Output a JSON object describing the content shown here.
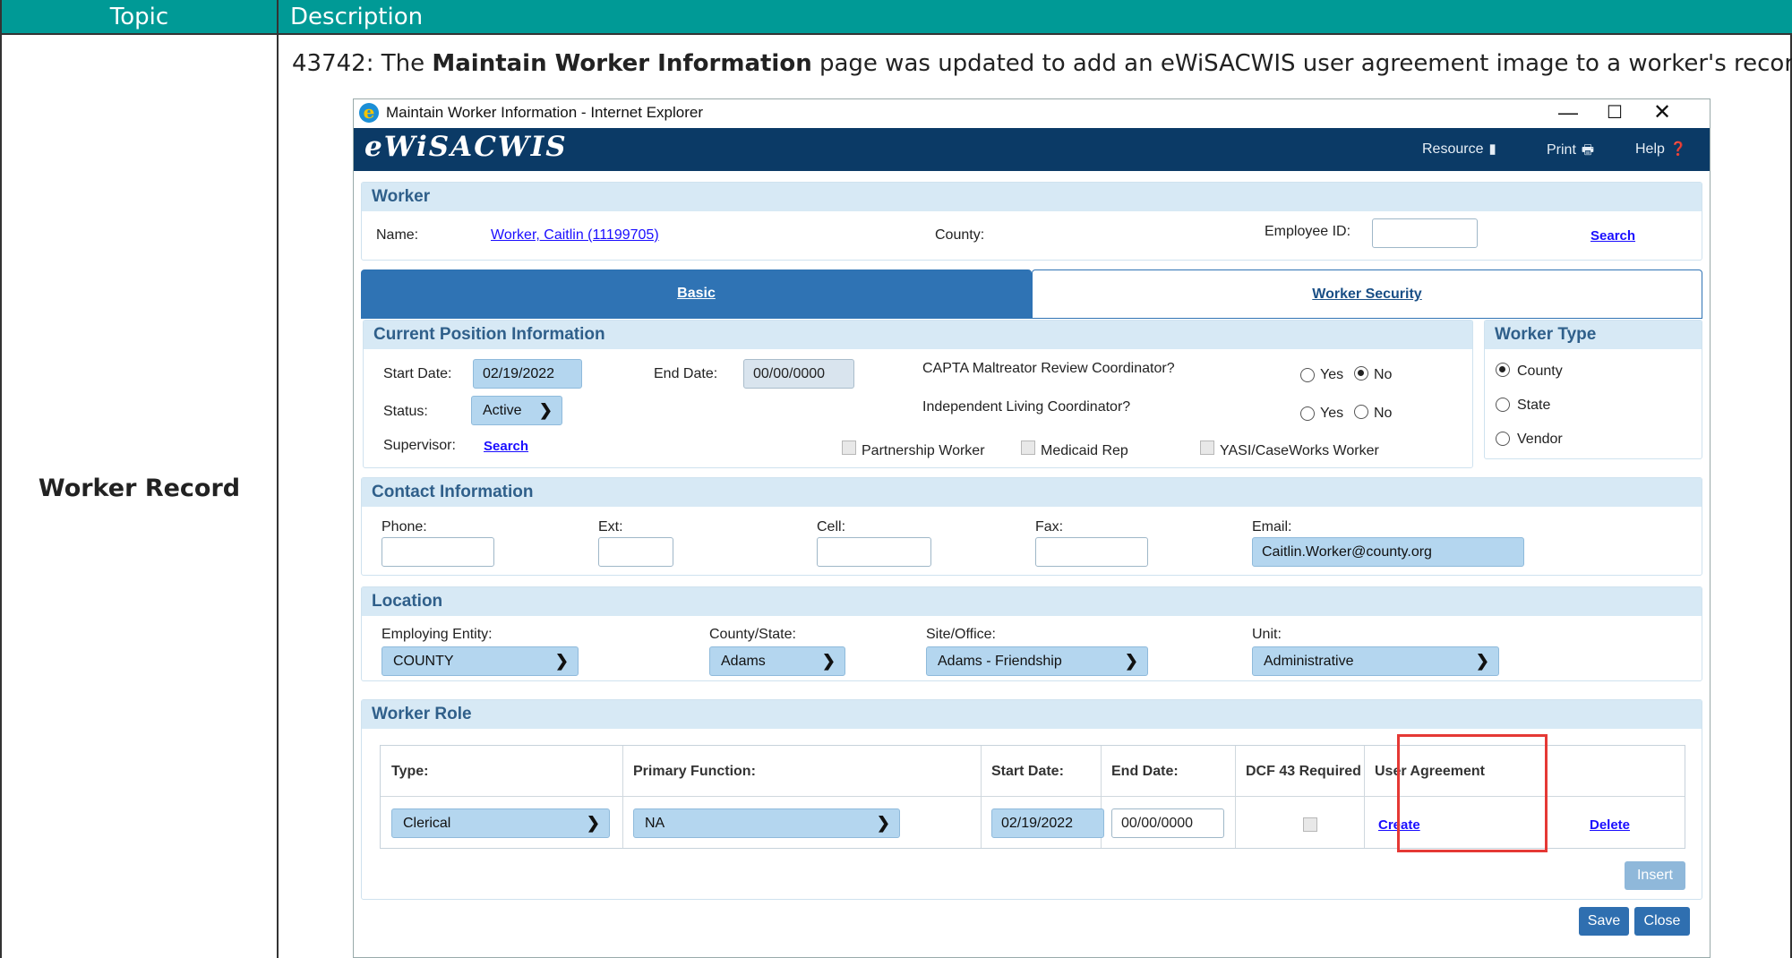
{
  "doc": {
    "header_topic": "Topic",
    "header_description": "Description",
    "topic": "Worker Record",
    "desc_prefix": "43742: The ",
    "desc_bold": "Maintain Worker Information",
    "desc_suffix": " page was updated to add an eWiSACWIS user agreement image to a worker's record."
  },
  "window": {
    "title": "Maintain Worker Information - Internet Explorer",
    "minimize": "—",
    "maximize": "☐",
    "close": "✕"
  },
  "banner": {
    "logo": "eWiSACWIS",
    "resource": "Resource",
    "print": "Print",
    "help": "Help"
  },
  "worker": {
    "heading": "Worker",
    "name_label": "Name:",
    "name_value": "Worker, Caitlin  (11199705)",
    "county_label": "County:",
    "employee_id_label": "Employee ID:",
    "employee_id_value": "",
    "search": "Search"
  },
  "tabs": {
    "basic": "Basic",
    "security": "Worker Security"
  },
  "position": {
    "heading": "Current Position Information",
    "start_label": "Start Date:",
    "start_value": "02/19/2022",
    "end_label": "End Date:",
    "end_value": "00/00/0000",
    "captа_question": "CAPTA Maltreator Review Coordinator?",
    "ilc_question": "Independent Living Coordinator?",
    "yes": "Yes",
    "no": "No",
    "status_label": "Status:",
    "status_value": "Active",
    "supervisor_label": "Supervisor:",
    "supervisor_search": "Search",
    "partnership": "Partnership Worker",
    "medicaid": "Medicaid Rep",
    "yasi": "YASI/CaseWorks Worker"
  },
  "worker_type": {
    "heading": "Worker Type",
    "county": "County",
    "state": "State",
    "vendor": "Vendor",
    "selected": "County"
  },
  "contact": {
    "heading": "Contact Information",
    "phone_label": "Phone:",
    "ext_label": "Ext:",
    "cell_label": "Cell:",
    "fax_label": "Fax:",
    "email_label": "Email:",
    "email_value": "Caitlin.Worker@county.org"
  },
  "location": {
    "heading": "Location",
    "entity_label": "Employing Entity:",
    "entity_value": "COUNTY",
    "county_state_label": "County/State:",
    "county_state_value": "Adams",
    "site_label": "Site/Office:",
    "site_value": "Adams - Friendship",
    "unit_label": "Unit:",
    "unit_value": "Administrative"
  },
  "role": {
    "heading": "Worker Role",
    "columns": {
      "type": "Type:",
      "primary": "Primary Function:",
      "start": "Start Date:",
      "end": "End Date:",
      "dcf": "DCF 43 Required",
      "agreement": "User Agreement"
    },
    "row": {
      "type": "Clerical",
      "primary": "NA",
      "start": "02/19/2022",
      "end": "00/00/0000",
      "agreement_link": "Create",
      "delete_link": "Delete"
    },
    "insert": "Insert",
    "save": "Save",
    "close": "Close"
  },
  "colors": {
    "doc_header": "#009a96",
    "banner": "#0b3a66",
    "panel_head": "#d7e9f5",
    "tab_active": "#2f73b4",
    "highlight": "#e53935"
  }
}
